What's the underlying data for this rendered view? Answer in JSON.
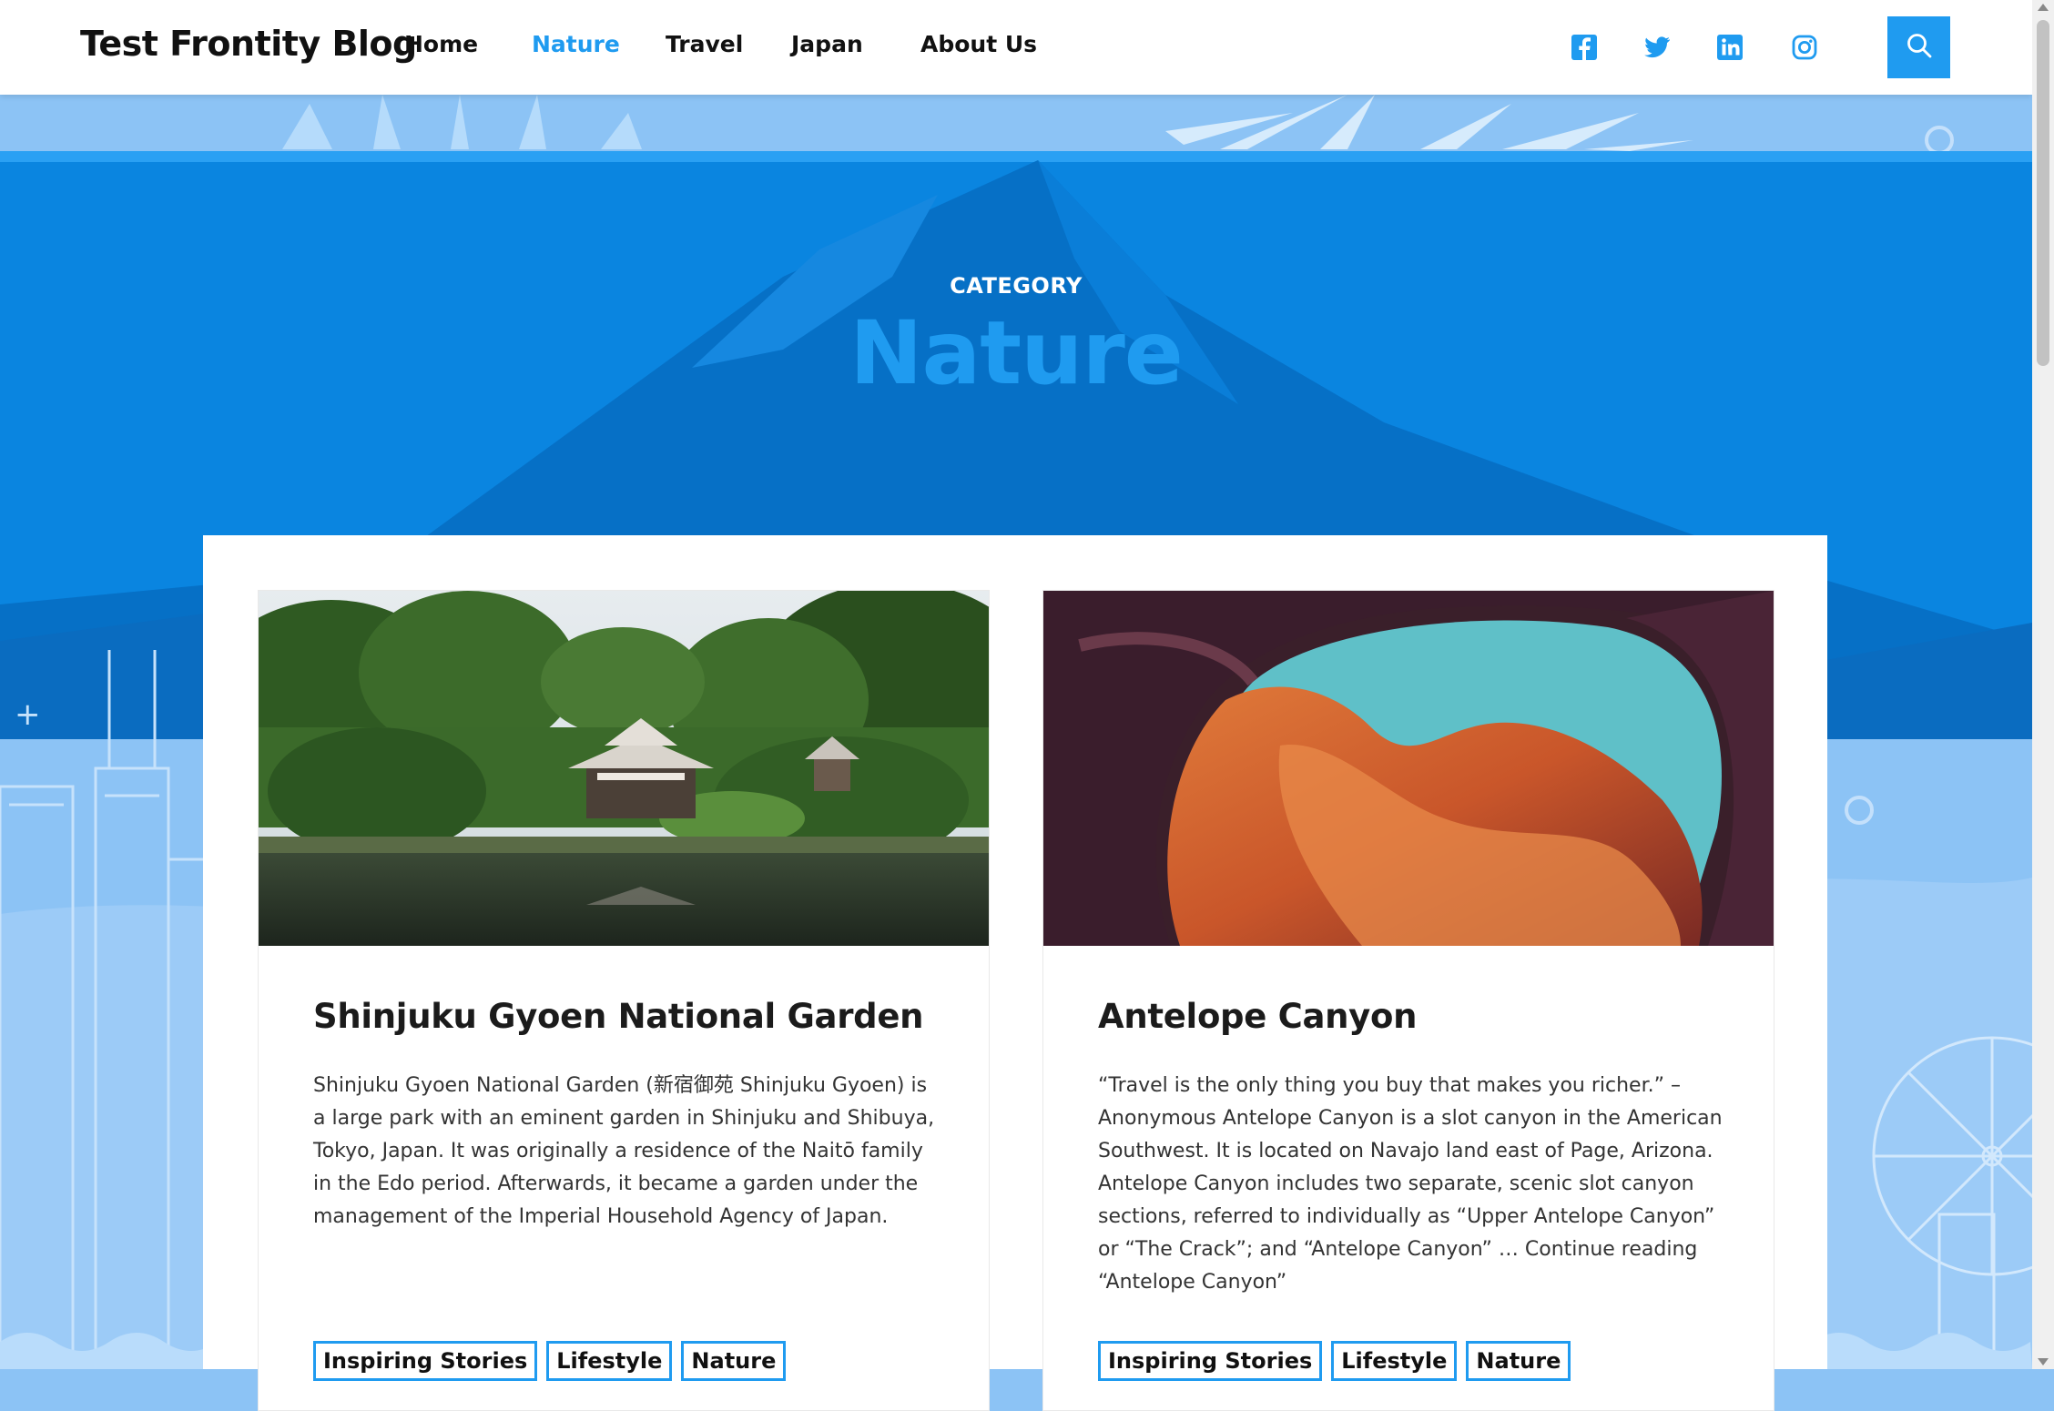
{
  "header": {
    "site_title": "Test Frontity Blog",
    "nav": [
      {
        "label": "Home",
        "active": false
      },
      {
        "label": "Nature",
        "active": true
      },
      {
        "label": "Travel",
        "active": false
      },
      {
        "label": "Japan",
        "active": false
      },
      {
        "label": "About Us",
        "active": false
      }
    ],
    "social_icons": [
      "facebook-icon",
      "twitter-icon",
      "linkedin-icon",
      "instagram-icon"
    ],
    "search_icon": "search-icon"
  },
  "hero": {
    "label": "CATEGORY",
    "title": "Nature"
  },
  "colors": {
    "accent": "#1f9bf0",
    "hero_blue": "#0a82d9",
    "sky": "#8cc3f5"
  },
  "posts": [
    {
      "title": "Shinjuku Gyoen National Garden",
      "excerpt": "Shinjuku Gyoen National Garden (新宿御苑 Shinjuku Gyoen) is a large park with an eminent garden in Shinjuku and Shibuya, Tokyo, Japan. It was originally a residence of the Naitō family in the Edo period. Afterwards, it became a garden under the management of the Imperial Household Agency of Japan.",
      "tags": [
        "Inspiring Stories",
        "Lifestyle",
        "Nature"
      ]
    },
    {
      "title": "Antelope Canyon",
      "excerpt": "“Travel is the only thing you buy that makes you richer.” – Anonymous Antelope Canyon is a slot canyon in the American Southwest. It is located on Navajo land east of Page, Arizona. Antelope Canyon includes two separate, scenic slot canyon sections, referred to individually as “Upper Antelope Canyon” or “The Crack”; and “Antelope Canyon” … Continue reading “Antelope Canyon”",
      "tags": [
        "Inspiring Stories",
        "Lifestyle",
        "Nature"
      ]
    }
  ]
}
